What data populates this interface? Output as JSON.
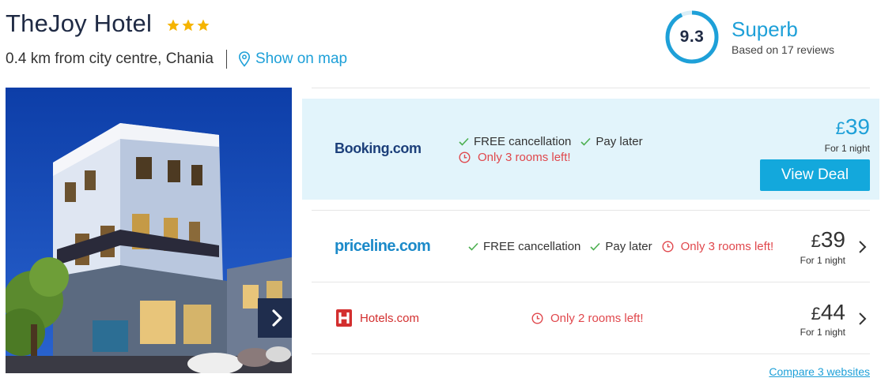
{
  "hotel": {
    "name": "TheJoy Hotel",
    "stars": 3,
    "distance": "0.4 km from city centre, Chania",
    "map_link": "Show on map"
  },
  "rating": {
    "score": "9.3",
    "score_value": 9.3,
    "label": "Superb",
    "reviews": "Based on 17 reviews"
  },
  "deals": [
    {
      "provider": "Booking.com",
      "features": [
        "FREE cancellation",
        "Pay later"
      ],
      "availability": "Only 3 rooms left!",
      "price": "39",
      "currency": "£",
      "per": "For 1 night",
      "cta": "View Deal"
    },
    {
      "provider": "priceline.com",
      "features": [
        "FREE cancellation",
        "Pay later"
      ],
      "availability": "Only 3 rooms left!",
      "price": "39",
      "currency": "£",
      "per": "For 1 night"
    },
    {
      "provider": "Hotels.com",
      "features": [],
      "availability": "Only 2 rooms left!",
      "price": "44",
      "currency": "£",
      "per": "For 1 night"
    }
  ],
  "compare_link": "Compare 3 websites",
  "colors": {
    "accent": "#1ea0d8",
    "highlight_bg": "#e2f4fb",
    "button": "#13a8dc",
    "warning": "#e0474c",
    "check": "#4caf50",
    "star": "#f5b400",
    "nav_button": "#1f2d4d"
  },
  "icons": [
    "star-icon",
    "map-pin-icon",
    "check-icon",
    "clock-icon",
    "chevron-right-icon"
  ]
}
